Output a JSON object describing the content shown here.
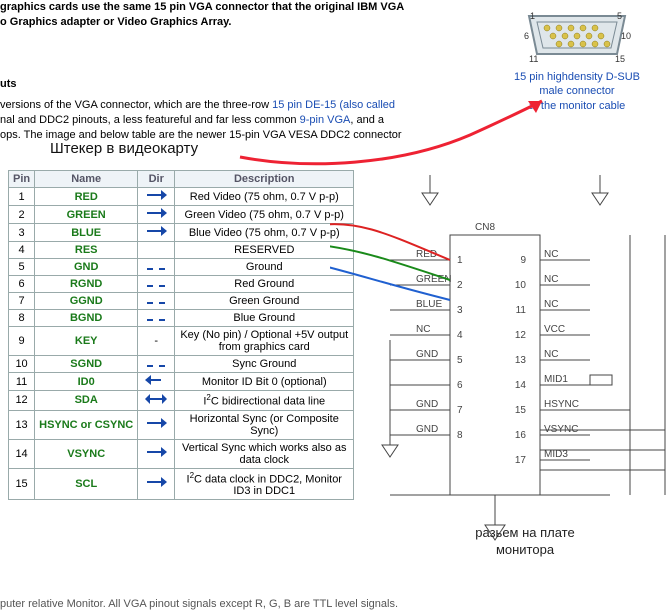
{
  "intro_line1": "graphics cards use the same 15 pin VGA connector that the original IBM VGA",
  "intro_line2": "o Graphics adapter or Video Graphics Array.",
  "section_heading": "uts",
  "para_pre": "versions of the VGA connector, which are the three-row ",
  "para_link1": "15 pin DE-15 (also called",
  "para_mid1": "nal",
  "para_mid2": " and DDC2 pinouts, a less featureful and far less common ",
  "para_link2": "9-pin VGA",
  "para_mid3": ", and a",
  "para_line3": "ops. The image and below table are the newer 15-pin VGA VESA DDC2 connector",
  "label_top": "Штекер в видеокарту",
  "connector_caption_l1": "15 pin highdensity D-SUB",
  "connector_caption_l2": "male connector",
  "connector_caption_l3": "at the monitor cable",
  "conn_pins": {
    "tl": "1",
    "tr": "5",
    "ml": "6",
    "mr": "10",
    "bl": "11",
    "br": "15"
  },
  "table": {
    "headers": {
      "pin": "Pin",
      "name": "Name",
      "dir": "Dir",
      "desc": "Description"
    },
    "rows": [
      {
        "pin": "1",
        "name": "RED",
        "dir": "right",
        "desc": "Red Video (75 ohm, 0.7 V p-p)"
      },
      {
        "pin": "2",
        "name": "GREEN",
        "dir": "right",
        "desc": "Green Video (75 ohm, 0.7 V p-p)"
      },
      {
        "pin": "3",
        "name": "BLUE",
        "dir": "right",
        "desc": "Blue Video (75 ohm, 0.7 V p-p)"
      },
      {
        "pin": "4",
        "name": "RES",
        "dir": "",
        "desc": "RESERVED"
      },
      {
        "pin": "5",
        "name": "GND",
        "dir": "dash",
        "desc": "Ground"
      },
      {
        "pin": "6",
        "name": "RGND",
        "dir": "dash",
        "desc": "Red Ground"
      },
      {
        "pin": "7",
        "name": "GGND",
        "dir": "dash",
        "desc": "Green Ground"
      },
      {
        "pin": "8",
        "name": "BGND",
        "dir": "dash",
        "desc": "Blue Ground"
      },
      {
        "pin": "9",
        "name": "KEY",
        "dir": "-",
        "desc": "Key (No pin) / Optional +5V output from graphics card"
      },
      {
        "pin": "10",
        "name": "SGND",
        "dir": "dash",
        "desc": "Sync Ground"
      },
      {
        "pin": "11",
        "name": "ID0",
        "dir": "left",
        "desc": "Monitor ID Bit 0 (optional)"
      },
      {
        "pin": "12",
        "name": "SDA",
        "dir": "both",
        "desc": "I2C bidirectional data line",
        "sup": true
      },
      {
        "pin": "13",
        "name": "HSYNC or CSYNC",
        "dir": "right",
        "desc": "Horizontal Sync (or Composite Sync)"
      },
      {
        "pin": "14",
        "name": "VSYNC",
        "dir": "right",
        "desc": "Vertical Sync which works also as data clock"
      },
      {
        "pin": "15",
        "name": "SCL",
        "dir": "right",
        "desc": "I2C data clock in DDC2, Monitor ID3 in DDC1",
        "sup": true
      }
    ]
  },
  "schem_label_l1": "разьем на плате",
  "schem_label_l2": "монитора",
  "cn_label": "CN8",
  "pin_labels_left": [
    "RED",
    "GREEN",
    "BLUE",
    "NC",
    "GND",
    "",
    "GND",
    "GND"
  ],
  "pin_labels_right": [
    "NC",
    "NC",
    "NC",
    "VCC",
    "NC",
    "MID1",
    "HSYNC",
    "VSYNC",
    "MID3"
  ],
  "pin_nums_left": [
    "1",
    "2",
    "3",
    "4",
    "5",
    "6",
    "7",
    "8"
  ],
  "pin_nums_right": [
    "9",
    "10",
    "11",
    "12",
    "13",
    "14",
    "15",
    "16",
    "17"
  ],
  "footer": "puter relative Monitor. All VGA pinout signals except R, G, B are TTL level signals."
}
